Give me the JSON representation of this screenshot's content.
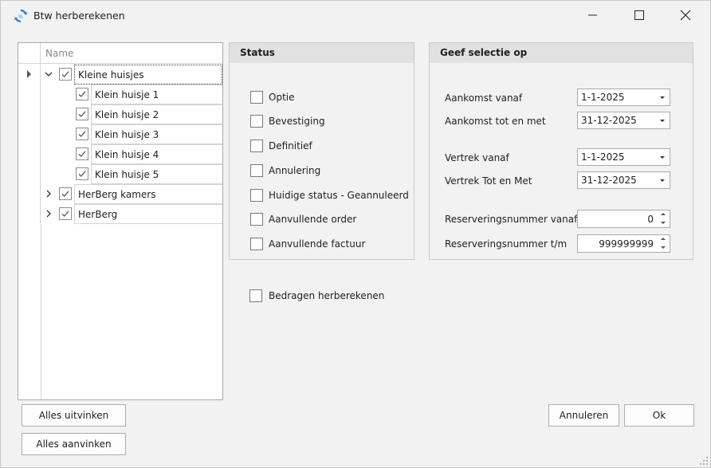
{
  "window": {
    "title": "Btw herberekenen",
    "icon": "refresh-cycle-icon",
    "accent_color": "#3a7bd5"
  },
  "tree": {
    "header": "Name",
    "nodes": [
      {
        "label": "Kleine huisjes",
        "checked": true,
        "expanded": true,
        "level": 0,
        "focused": true
      },
      {
        "label": "Klein huisje 1",
        "checked": true,
        "level": 1
      },
      {
        "label": "Klein huisje 2",
        "checked": true,
        "level": 1
      },
      {
        "label": "Klein huisje 3",
        "checked": true,
        "level": 1
      },
      {
        "label": "Klein huisje 4",
        "checked": true,
        "level": 1
      },
      {
        "label": "Klein huisje 5",
        "checked": true,
        "level": 1
      },
      {
        "label": "HerBerg kamers",
        "checked": true,
        "expanded": false,
        "level": 0
      },
      {
        "label": "HerBerg",
        "checked": true,
        "expanded": false,
        "level": 0
      }
    ]
  },
  "status": {
    "title": "Status",
    "items": [
      {
        "label": "Optie",
        "checked": false
      },
      {
        "label": "Bevestiging",
        "checked": false
      },
      {
        "label": "Definitief",
        "checked": false
      },
      {
        "label": "Annulering",
        "checked": false
      },
      {
        "label": "Huidige status - Geannuleerd",
        "checked": false
      },
      {
        "label": "Aanvullende order",
        "checked": false
      },
      {
        "label": "Aanvullende factuur",
        "checked": false
      }
    ]
  },
  "selection": {
    "title": "Geef selectie op",
    "arrival_from_label": "Aankomst vanaf",
    "arrival_from_value": "1-1-2025",
    "arrival_to_label": "Aankomst tot en met",
    "arrival_to_value": "31-12-2025",
    "departure_from_label": "Vertrek vanaf",
    "departure_from_value": "1-1-2025",
    "departure_to_label": "Vertrek Tot en Met",
    "departure_to_value": "31-12-2025",
    "resnr_from_label": "Reserveringsnummer vanaf",
    "resnr_from_value": "0",
    "resnr_to_label": "Reserveringsnummer t/m",
    "resnr_to_value": "999999999"
  },
  "recalc_amounts": {
    "label": "Bedragen herberekenen",
    "checked": false
  },
  "buttons": {
    "uncheck_all": "Alles uitvinken",
    "check_all": "Alles aanvinken",
    "cancel": "Annuleren",
    "ok": "Ok"
  }
}
